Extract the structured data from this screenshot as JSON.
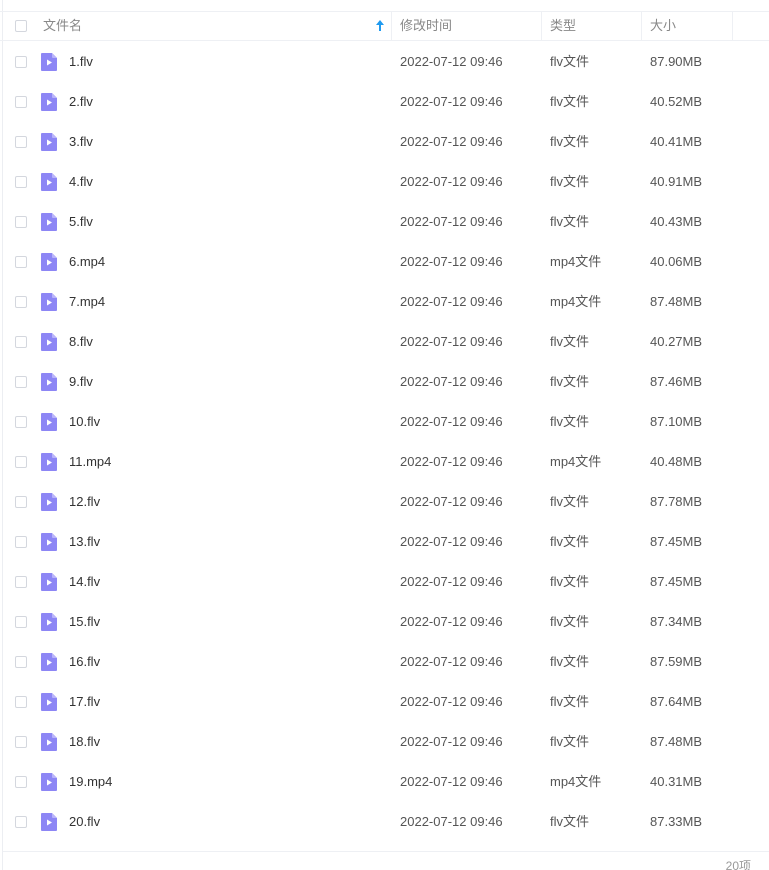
{
  "columns": {
    "name": "文件名",
    "modified": "修改时间",
    "type": "类型",
    "size": "大小"
  },
  "sort": {
    "column": "name",
    "direction": "ascending",
    "icon": "arrow-up-icon"
  },
  "file_icon": "video-file-icon",
  "rows": [
    {
      "name": "1.flv",
      "modified": "2022-07-12 09:46",
      "type": "flv文件",
      "size": "87.90MB"
    },
    {
      "name": "2.flv",
      "modified": "2022-07-12 09:46",
      "type": "flv文件",
      "size": "40.52MB"
    },
    {
      "name": "3.flv",
      "modified": "2022-07-12 09:46",
      "type": "flv文件",
      "size": "40.41MB"
    },
    {
      "name": "4.flv",
      "modified": "2022-07-12 09:46",
      "type": "flv文件",
      "size": "40.91MB"
    },
    {
      "name": "5.flv",
      "modified": "2022-07-12 09:46",
      "type": "flv文件",
      "size": "40.43MB"
    },
    {
      "name": "6.mp4",
      "modified": "2022-07-12 09:46",
      "type": "mp4文件",
      "size": "40.06MB"
    },
    {
      "name": "7.mp4",
      "modified": "2022-07-12 09:46",
      "type": "mp4文件",
      "size": "87.48MB"
    },
    {
      "name": "8.flv",
      "modified": "2022-07-12 09:46",
      "type": "flv文件",
      "size": "40.27MB"
    },
    {
      "name": "9.flv",
      "modified": "2022-07-12 09:46",
      "type": "flv文件",
      "size": "87.46MB"
    },
    {
      "name": "10.flv",
      "modified": "2022-07-12 09:46",
      "type": "flv文件",
      "size": "87.10MB"
    },
    {
      "name": "11.mp4",
      "modified": "2022-07-12 09:46",
      "type": "mp4文件",
      "size": "40.48MB"
    },
    {
      "name": "12.flv",
      "modified": "2022-07-12 09:46",
      "type": "flv文件",
      "size": "87.78MB"
    },
    {
      "name": "13.flv",
      "modified": "2022-07-12 09:46",
      "type": "flv文件",
      "size": "87.45MB"
    },
    {
      "name": "14.flv",
      "modified": "2022-07-12 09:46",
      "type": "flv文件",
      "size": "87.45MB"
    },
    {
      "name": "15.flv",
      "modified": "2022-07-12 09:46",
      "type": "flv文件",
      "size": "87.34MB"
    },
    {
      "name": "16.flv",
      "modified": "2022-07-12 09:46",
      "type": "flv文件",
      "size": "87.59MB"
    },
    {
      "name": "17.flv",
      "modified": "2022-07-12 09:46",
      "type": "flv文件",
      "size": "87.64MB"
    },
    {
      "name": "18.flv",
      "modified": "2022-07-12 09:46",
      "type": "flv文件",
      "size": "87.48MB"
    },
    {
      "name": "19.mp4",
      "modified": "2022-07-12 09:46",
      "type": "mp4文件",
      "size": "40.31MB"
    },
    {
      "name": "20.flv",
      "modified": "2022-07-12 09:46",
      "type": "flv文件",
      "size": "87.33MB"
    }
  ],
  "footer": {
    "count": "20项"
  },
  "colors": {
    "file_icon": "#8d86f5",
    "file_icon_fold": "#b9b4fa",
    "sort_arrow": "#1f9aef"
  }
}
